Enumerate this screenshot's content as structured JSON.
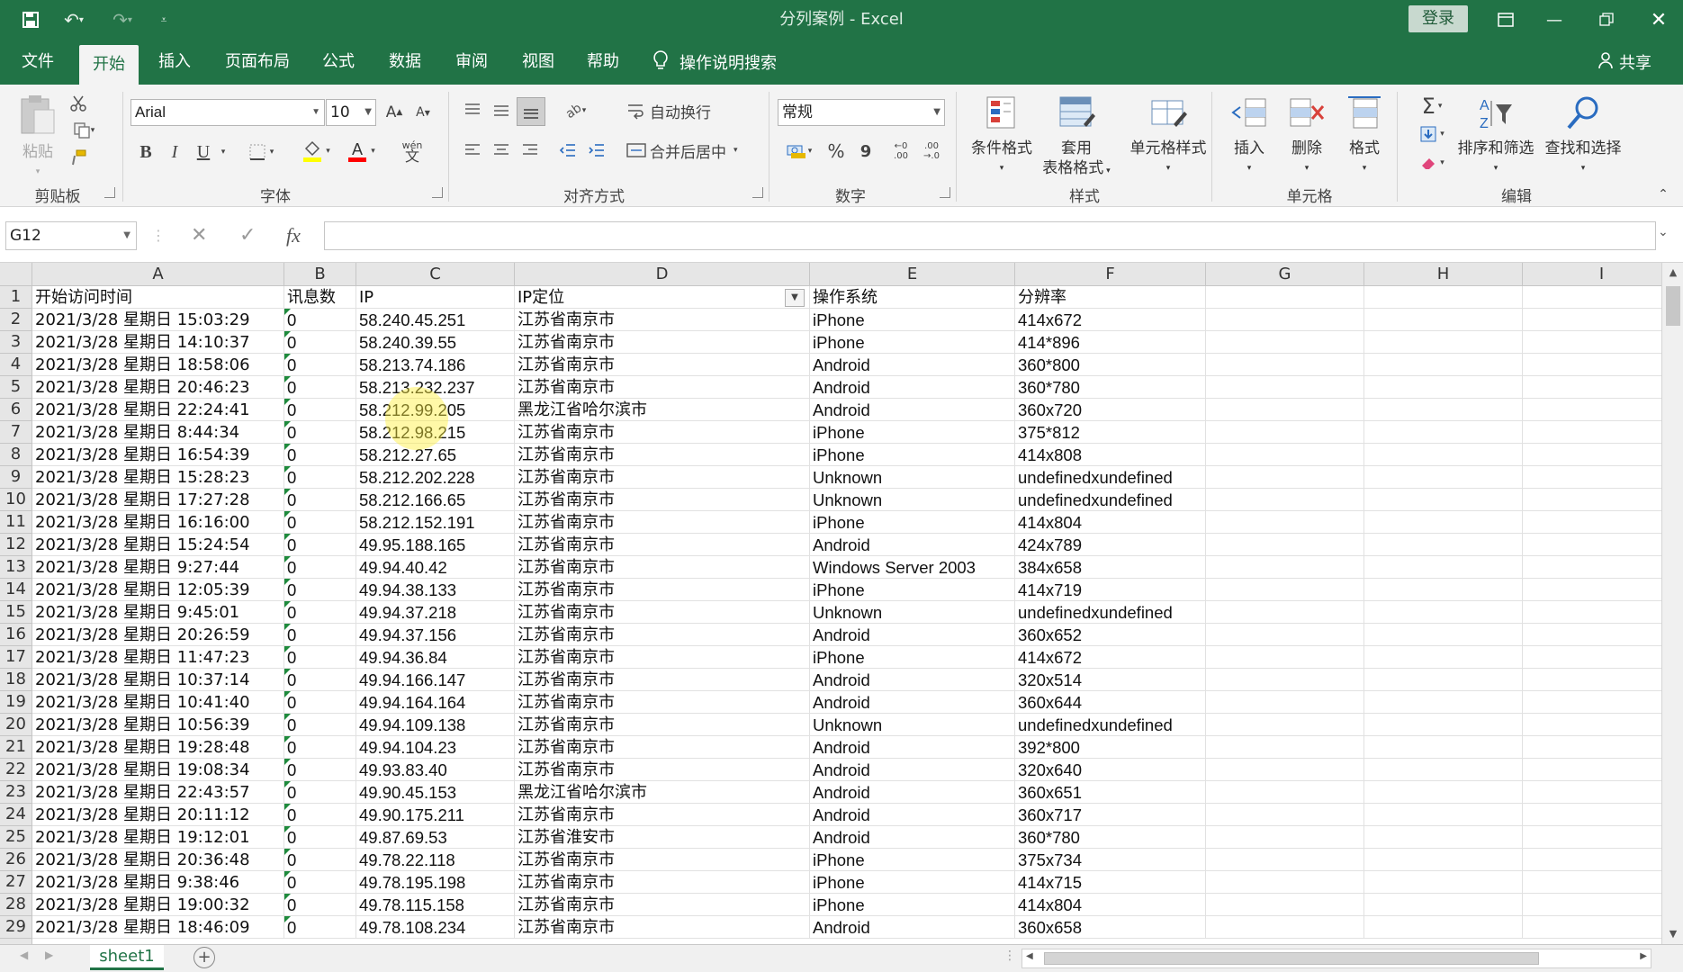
{
  "window": {
    "title": "分列案例  -  Excel",
    "login_label": "登录"
  },
  "menu": {
    "tabs": [
      "文件",
      "开始",
      "插入",
      "页面布局",
      "公式",
      "数据",
      "审阅",
      "视图",
      "帮助"
    ],
    "active_tab": "开始",
    "search_label": "操作说明搜索",
    "share_label": "共享"
  },
  "ribbon": {
    "clipboard": {
      "label": "剪贴板",
      "paste": "粘贴"
    },
    "font": {
      "label": "字体",
      "name": "Arial",
      "size": "10",
      "bold": "B",
      "italic": "I",
      "underline": "U",
      "wen": "wén"
    },
    "alignment": {
      "label": "对齐方式",
      "wrap": "自动换行",
      "merge": "合并后居中"
    },
    "number": {
      "label": "数字",
      "format": "常规",
      "percent": "%",
      "comma": "9"
    },
    "styles": {
      "label": "样式",
      "conditional": "条件格式",
      "table_line1": "套用",
      "table_line2": "表格格式",
      "cell_styles": "单元格样式"
    },
    "cells": {
      "label": "单元格",
      "insert": "插入",
      "delete": "删除",
      "format": "格式"
    },
    "editing": {
      "label": "编辑",
      "sort": "排序和筛选",
      "find": "查找和选择"
    }
  },
  "formula_bar": {
    "name_box": "G12",
    "fx": "fx",
    "value": ""
  },
  "grid": {
    "columns": [
      "A",
      "B",
      "C",
      "D",
      "E",
      "F",
      "G",
      "H",
      "I"
    ],
    "header_row": [
      "开始访问时间",
      "讯息数",
      "IP",
      "IP定位",
      "操作系统",
      "分辨率"
    ],
    "rows": [
      {
        "n": "2",
        "a": "2021/3/28 星期日 15:03:29",
        "b": "0",
        "c": "58.240.45.251",
        "d": "江苏省南京市",
        "e": "iPhone",
        "f": "414x672"
      },
      {
        "n": "3",
        "a": "2021/3/28 星期日 14:10:37",
        "b": "0",
        "c": "58.240.39.55",
        "d": "江苏省南京市",
        "e": "iPhone",
        "f": "414*896"
      },
      {
        "n": "4",
        "a": "2021/3/28 星期日 18:58:06",
        "b": "0",
        "c": "58.213.74.186",
        "d": "江苏省南京市",
        "e": "Android",
        "f": "360*800"
      },
      {
        "n": "5",
        "a": "2021/3/28 星期日 20:46:23",
        "b": "0",
        "c": "58.213.232.237",
        "d": "江苏省南京市",
        "e": "Android",
        "f": "360*780"
      },
      {
        "n": "6",
        "a": "2021/3/28 星期日 22:24:41",
        "b": "0",
        "c": "58.212.99.205",
        "d": "黑龙江省哈尔滨市",
        "e": "Android",
        "f": "360x720"
      },
      {
        "n": "7",
        "a": "2021/3/28 星期日 8:44:34",
        "b": "0",
        "c": "58.212.98.215",
        "d": "江苏省南京市",
        "e": "iPhone",
        "f": "375*812"
      },
      {
        "n": "8",
        "a": "2021/3/28 星期日 16:54:39",
        "b": "0",
        "c": "58.212.27.65",
        "d": "江苏省南京市",
        "e": "iPhone",
        "f": "414x808"
      },
      {
        "n": "9",
        "a": "2021/3/28 星期日 15:28:23",
        "b": "0",
        "c": "58.212.202.228",
        "d": "江苏省南京市",
        "e": "Unknown",
        "f": "undefinedxundefined"
      },
      {
        "n": "10",
        "a": "2021/3/28 星期日 17:27:28",
        "b": "0",
        "c": "58.212.166.65",
        "d": "江苏省南京市",
        "e": "Unknown",
        "f": "undefinedxundefined"
      },
      {
        "n": "11",
        "a": "2021/3/28 星期日 16:16:00",
        "b": "0",
        "c": "58.212.152.191",
        "d": "江苏省南京市",
        "e": "iPhone",
        "f": "414x804"
      },
      {
        "n": "12",
        "a": "2021/3/28 星期日 15:24:54",
        "b": "0",
        "c": "49.95.188.165",
        "d": "江苏省南京市",
        "e": "Android",
        "f": "424x789"
      },
      {
        "n": "13",
        "a": "2021/3/28 星期日 9:27:44",
        "b": "0",
        "c": "49.94.40.42",
        "d": "江苏省南京市",
        "e": "Windows Server 2003",
        "f": "384x658"
      },
      {
        "n": "14",
        "a": "2021/3/28 星期日 12:05:39",
        "b": "0",
        "c": "49.94.38.133",
        "d": "江苏省南京市",
        "e": "iPhone",
        "f": "414x719"
      },
      {
        "n": "15",
        "a": "2021/3/28 星期日 9:45:01",
        "b": "0",
        "c": "49.94.37.218",
        "d": "江苏省南京市",
        "e": "Unknown",
        "f": "undefinedxundefined"
      },
      {
        "n": "16",
        "a": "2021/3/28 星期日 20:26:59",
        "b": "0",
        "c": "49.94.37.156",
        "d": "江苏省南京市",
        "e": "Android",
        "f": "360x652"
      },
      {
        "n": "17",
        "a": "2021/3/28 星期日 11:47:23",
        "b": "0",
        "c": "49.94.36.84",
        "d": "江苏省南京市",
        "e": "iPhone",
        "f": "414x672"
      },
      {
        "n": "18",
        "a": "2021/3/28 星期日 10:37:14",
        "b": "0",
        "c": "49.94.166.147",
        "d": "江苏省南京市",
        "e": "Android",
        "f": "320x514"
      },
      {
        "n": "19",
        "a": "2021/3/28 星期日 10:41:40",
        "b": "0",
        "c": "49.94.164.164",
        "d": "江苏省南京市",
        "e": "Android",
        "f": "360x644"
      },
      {
        "n": "20",
        "a": "2021/3/28 星期日 10:56:39",
        "b": "0",
        "c": "49.94.109.138",
        "d": "江苏省南京市",
        "e": "Unknown",
        "f": "undefinedxundefined"
      },
      {
        "n": "21",
        "a": "2021/3/28 星期日 19:28:48",
        "b": "0",
        "c": "49.94.104.23",
        "d": "江苏省南京市",
        "e": "Android",
        "f": "392*800"
      },
      {
        "n": "22",
        "a": "2021/3/28 星期日 19:08:34",
        "b": "0",
        "c": "49.93.83.40",
        "d": "江苏省南京市",
        "e": "Android",
        "f": "320x640"
      },
      {
        "n": "23",
        "a": "2021/3/28 星期日 22:43:57",
        "b": "0",
        "c": "49.90.45.153",
        "d": "黑龙江省哈尔滨市",
        "e": "Android",
        "f": "360x651"
      },
      {
        "n": "24",
        "a": "2021/3/28 星期日 20:11:12",
        "b": "0",
        "c": "49.90.175.211",
        "d": "江苏省南京市",
        "e": "Android",
        "f": "360x717"
      },
      {
        "n": "25",
        "a": "2021/3/28 星期日 19:12:01",
        "b": "0",
        "c": "49.87.69.53",
        "d": "江苏省淮安市",
        "e": "Android",
        "f": "360*780"
      },
      {
        "n": "26",
        "a": "2021/3/28 星期日 20:36:48",
        "b": "0",
        "c": "49.78.22.118",
        "d": "江苏省南京市",
        "e": "iPhone",
        "f": "375x734"
      },
      {
        "n": "27",
        "a": "2021/3/28 星期日 9:38:46",
        "b": "0",
        "c": "49.78.195.198",
        "d": "江苏省南京市",
        "e": "iPhone",
        "f": "414x715"
      },
      {
        "n": "28",
        "a": "2021/3/28 星期日 19:00:32",
        "b": "0",
        "c": "49.78.115.158",
        "d": "江苏省南京市",
        "e": "iPhone",
        "f": "414x804"
      },
      {
        "n": "29",
        "a": "2021/3/28 星期日 18:46:09",
        "b": "0",
        "c": "49.78.108.234",
        "d": "江苏省南京市",
        "e": "Android",
        "f": "360x658"
      }
    ]
  },
  "sheets": {
    "tabs": [
      "sheet1"
    ]
  },
  "colors": {
    "accent": "#217346",
    "header_bg": "#e6e6e6",
    "number_tag": "#1e8a3c"
  }
}
